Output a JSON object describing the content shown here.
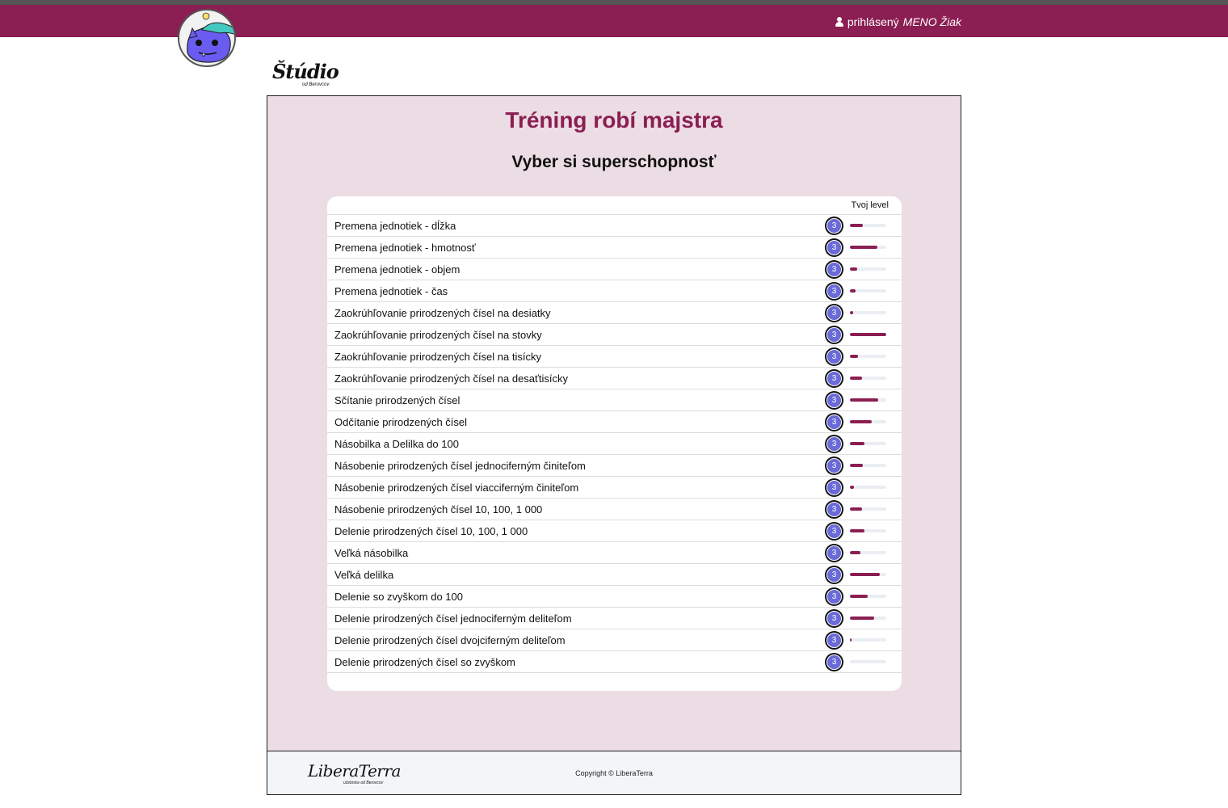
{
  "header": {
    "user_prefix": "prihlásený",
    "user_name": "MENO Žiak"
  },
  "brand": {
    "name": "Štúdio",
    "sub": "od Berovcov"
  },
  "main": {
    "title": "Tréning robí majstra",
    "subtitle": "Vyber si superschopnosť",
    "level_header": "Tvoj level"
  },
  "skills": [
    {
      "label": "Premena jednotiek - dĺžka",
      "level": "3",
      "progress": 0.35
    },
    {
      "label": "Premena jednotiek - hmotnosť",
      "level": "3",
      "progress": 0.75
    },
    {
      "label": "Premena jednotiek - objem",
      "level": "3",
      "progress": 0.2
    },
    {
      "label": "Premena jednotiek - čas",
      "level": "3",
      "progress": 0.16
    },
    {
      "label": "Zaokrúhľovanie prirodzených čísel na desiatky",
      "level": "3",
      "progress": 0.08
    },
    {
      "label": "Zaokrúhľovanie prirodzených čísel na stovky",
      "level": "3",
      "progress": 1.0
    },
    {
      "label": "Zaokrúhľovanie prirodzených čísel na tisícky",
      "level": "3",
      "progress": 0.22
    },
    {
      "label": "Zaokrúhľovanie prirodzených čísel na desaťtisícky",
      "level": "3",
      "progress": 0.33
    },
    {
      "label": "Sčítanie prirodzených čísel",
      "level": "3",
      "progress": 0.77
    },
    {
      "label": "Odčítanie prirodzených čísel",
      "level": "3",
      "progress": 0.6
    },
    {
      "label": "Násobilka a Delilka do 100",
      "level": "3",
      "progress": 0.4
    },
    {
      "label": "Násobenie prirodzených čísel jednociferným činiteľom",
      "level": "3",
      "progress": 0.35
    },
    {
      "label": "Násobenie prirodzených čísel viacciferným činiteľom",
      "level": "3",
      "progress": 0.1
    },
    {
      "label": "Násobenie prirodzených čísel 10, 100, 1 000",
      "level": "3",
      "progress": 0.33
    },
    {
      "label": "Delenie prirodzených čísel 10, 100, 1 000",
      "level": "3",
      "progress": 0.4
    },
    {
      "label": "Veľká násobilka",
      "level": "3",
      "progress": 0.28
    },
    {
      "label": "Veľká delilka",
      "level": "3",
      "progress": 0.83
    },
    {
      "label": "Delenie so zvyškom do 100",
      "level": "3",
      "progress": 0.48
    },
    {
      "label": "Delenie prirodzených čísel jednociferným deliteľom",
      "level": "3",
      "progress": 0.67
    },
    {
      "label": "Delenie prirodzených čísel dvojciferným deliteľom",
      "level": "3",
      "progress": 0.05
    },
    {
      "label": "Delenie prirodzených čísel so zvyškom",
      "level": "3",
      "progress": 0.0
    }
  ],
  "footer": {
    "logo_name": "LiberaTerra",
    "logo_sub": "učebnice od Berovcov",
    "copyright": "Copyright © LiberaTerra"
  },
  "colors": {
    "brand": "#8b1e52",
    "panel_bg": "#ecdde4",
    "badge": "#6a6ad8"
  },
  "icons": {
    "user": "user-icon",
    "avatar": "cat-mascot-avatar"
  }
}
